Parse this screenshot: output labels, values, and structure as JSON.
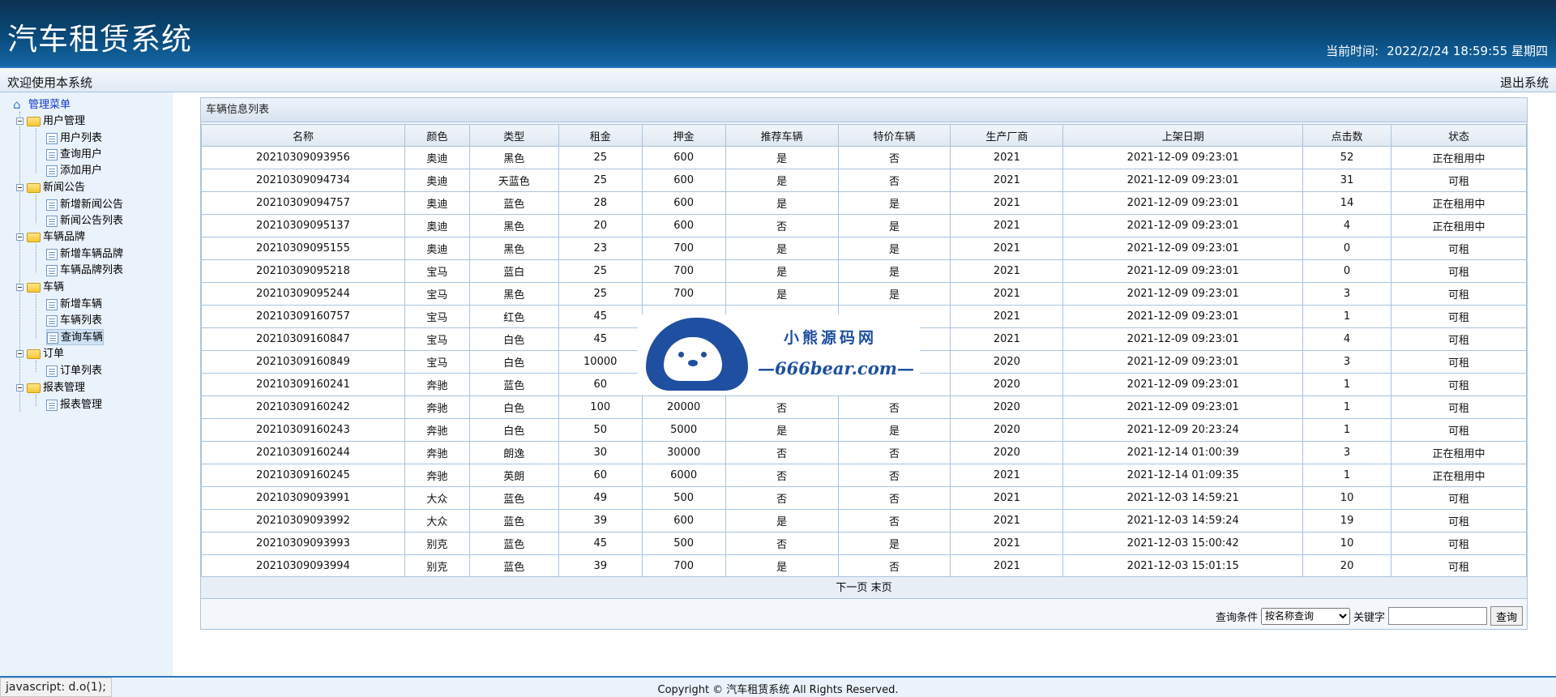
{
  "header": {
    "app_title": "汽车租赁系统",
    "time_label": "当前时间:",
    "datetime": "2022/2/24 18:59:55 星期四"
  },
  "subbar": {
    "welcome": "欢迎使用本系统",
    "logout": "退出系统"
  },
  "sidebar": {
    "root": "管理菜单",
    "groups": [
      {
        "label": "用户管理",
        "items": [
          "用户列表",
          "查询用户",
          "添加用户"
        ]
      },
      {
        "label": "新闻公告",
        "items": [
          "新增新闻公告",
          "新闻公告列表"
        ]
      },
      {
        "label": "车辆品牌",
        "items": [
          "新增车辆品牌",
          "车辆品牌列表"
        ]
      },
      {
        "label": "车辆",
        "items": [
          "新增车辆",
          "车辆列表",
          "查询车辆"
        ]
      },
      {
        "label": "订单",
        "items": [
          "订单列表"
        ]
      },
      {
        "label": "报表管理",
        "items": [
          "报表管理"
        ]
      }
    ],
    "selected": "查询车辆"
  },
  "panel": {
    "title": "车辆信息列表",
    "columns": [
      "名称",
      "颜色",
      "类型",
      "租金",
      "押金",
      "推荐车辆",
      "特价车辆",
      "生产厂商",
      "上架日期",
      "点击数",
      "状态"
    ],
    "rows": [
      [
        "20210309093956",
        "奥迪",
        "黑色",
        "25",
        "600",
        "是",
        "否",
        "2021",
        "2021-12-09 09:23:01",
        "52",
        "正在租用中"
      ],
      [
        "20210309094734",
        "奥迪",
        "天蓝色",
        "25",
        "600",
        "是",
        "否",
        "2021",
        "2021-12-09 09:23:01",
        "31",
        "可租"
      ],
      [
        "20210309094757",
        "奥迪",
        "蓝色",
        "28",
        "600",
        "是",
        "是",
        "2021",
        "2021-12-09 09:23:01",
        "14",
        "正在租用中"
      ],
      [
        "20210309095137",
        "奥迪",
        "黑色",
        "20",
        "600",
        "否",
        "是",
        "2021",
        "2021-12-09 09:23:01",
        "4",
        "正在租用中"
      ],
      [
        "20210309095155",
        "奥迪",
        "黑色",
        "23",
        "700",
        "是",
        "是",
        "2021",
        "2021-12-09 09:23:01",
        "0",
        "可租"
      ],
      [
        "20210309095218",
        "宝马",
        "蓝白",
        "25",
        "700",
        "是",
        "是",
        "2021",
        "2021-12-09 09:23:01",
        "0",
        "可租"
      ],
      [
        "20210309095244",
        "宝马",
        "黑色",
        "25",
        "700",
        "是",
        "是",
        "2021",
        "2021-12-09 09:23:01",
        "3",
        "可租"
      ],
      [
        "20210309160757",
        "宝马",
        "红色",
        "45",
        "",
        "",
        "",
        "2021",
        "2021-12-09 09:23:01",
        "1",
        "可租"
      ],
      [
        "20210309160847",
        "宝马",
        "白色",
        "45",
        "",
        "",
        "",
        "2021",
        "2021-12-09 09:23:01",
        "4",
        "可租"
      ],
      [
        "20210309160849",
        "宝马",
        "白色",
        "10000",
        "",
        "",
        "",
        "2020",
        "2021-12-09 09:23:01",
        "3",
        "可租"
      ],
      [
        "20210309160241",
        "奔驰",
        "蓝色",
        "60",
        "",
        "",
        "",
        "2020",
        "2021-12-09 09:23:01",
        "1",
        "可租"
      ],
      [
        "20210309160242",
        "奔驰",
        "白色",
        "100",
        "20000",
        "否",
        "否",
        "2020",
        "2021-12-09 09:23:01",
        "1",
        "可租"
      ],
      [
        "20210309160243",
        "奔驰",
        "白色",
        "50",
        "5000",
        "是",
        "是",
        "2020",
        "2021-12-09 20:23:24",
        "1",
        "可租"
      ],
      [
        "20210309160244",
        "奔驰",
        "朗逸",
        "30",
        "30000",
        "否",
        "否",
        "2020",
        "2021-12-14 01:00:39",
        "3",
        "正在租用中"
      ],
      [
        "20210309160245",
        "奔驰",
        "英朗",
        "60",
        "6000",
        "否",
        "否",
        "2021",
        "2021-12-14 01:09:35",
        "1",
        "正在租用中"
      ],
      [
        "20210309093991",
        "大众",
        "蓝色",
        "49",
        "500",
        "否",
        "否",
        "2021",
        "2021-12-03 14:59:21",
        "10",
        "可租"
      ],
      [
        "20210309093992",
        "大众",
        "蓝色",
        "39",
        "600",
        "是",
        "否",
        "2021",
        "2021-12-03 14:59:24",
        "19",
        "可租"
      ],
      [
        "20210309093993",
        "别克",
        "蓝色",
        "45",
        "500",
        "否",
        "是",
        "2021",
        "2021-12-03 15:00:42",
        "10",
        "可租"
      ],
      [
        "20210309093994",
        "别克",
        "蓝色",
        "39",
        "700",
        "是",
        "否",
        "2021",
        "2021-12-03 15:01:15",
        "20",
        "可租"
      ]
    ],
    "pager": {
      "next": "下一页",
      "last": "末页"
    },
    "search": {
      "condition_label": "查询条件",
      "selected_option": "按名称查询",
      "keyword_label": "关键字",
      "keyword_value": "",
      "button": "查询"
    }
  },
  "watermark": {
    "line1": "小熊源码网",
    "line2": "—666bear.com—"
  },
  "footer": {
    "copyright": "Copyright © 汽车租赁系统 All Rights Reserved.",
    "status_url": "javascript: d.o(1);"
  },
  "colors": {
    "header_dark": "#0b3150",
    "header_light": "#1467a6",
    "accent_line": "#2c78c2",
    "grid_border": "#a9c4de",
    "sidebar_bg": "#eaf2fb",
    "watermark_blue": "#1f4fa0"
  }
}
